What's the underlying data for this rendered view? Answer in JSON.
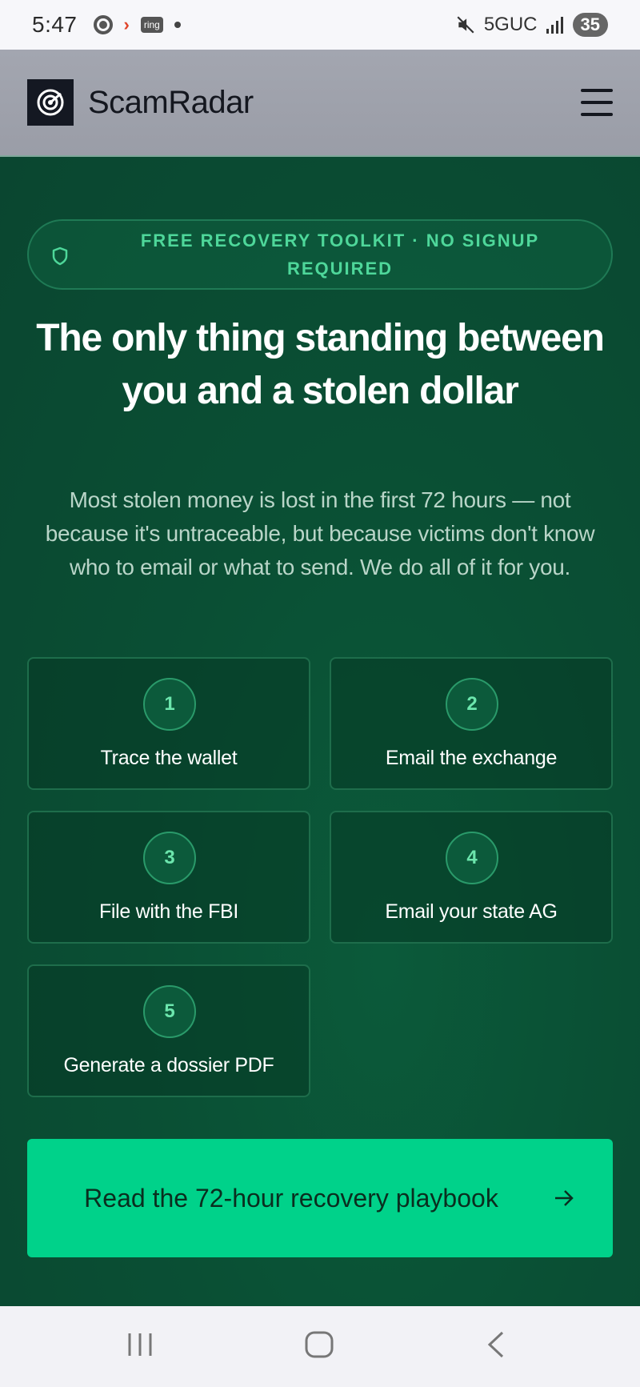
{
  "status_bar": {
    "time": "5:47",
    "ring_label": "ring",
    "network": "5GUC",
    "battery": "35"
  },
  "header": {
    "brand": "ScamRadar",
    "menu_icon": "hamburger-menu-icon"
  },
  "hero": {
    "badge_text": "FREE RECOVERY TOOLKIT · NO SIGNUP REQUIRED",
    "headline": "The only thing standing between you and a stolen dollar",
    "subtext": "Most stolen money is lost in the first 72 hours — not because it's untraceable, but because victims don't know who to email or what to send. We do all of it for you."
  },
  "steps": [
    {
      "number": "1",
      "label": "Trace the wallet"
    },
    {
      "number": "2",
      "label": "Email the exchange"
    },
    {
      "number": "3",
      "label": "File with the FBI"
    },
    {
      "number": "4",
      "label": "Email your state AG"
    },
    {
      "number": "5",
      "label": "Generate a dossier PDF"
    }
  ],
  "cta": {
    "label": "Read the 72-hour recovery playbook",
    "icon": "arrow-right-icon"
  },
  "colors": {
    "accent": "#00d28a",
    "background": "#0a4f34",
    "badge_text": "#4ed79a"
  }
}
